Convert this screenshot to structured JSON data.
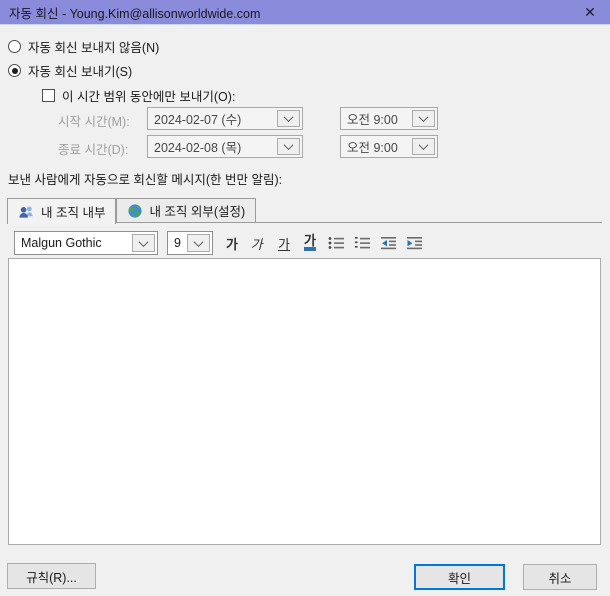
{
  "window": {
    "title": "자동 회신 - Young.Kim@allisonworldwide.com",
    "close_glyph": "✕"
  },
  "options": {
    "radio_no_reply_label": "자동 회신 보내지 않음(N)",
    "radio_no_reply_checked": false,
    "radio_send_label": "자동 회신 보내기(S)",
    "radio_send_checked": true,
    "checkbox_time_range_label": "이 시간 범위 동안에만 보내기(O):",
    "checkbox_time_range_checked": false,
    "start_label": "시작 시간(M):",
    "start_date": "2024-02-07 (수)",
    "start_time": "오전 9:00",
    "end_label": "종료 시간(D):",
    "end_date": "2024-02-08 (목)",
    "end_time": "오전 9:00"
  },
  "message_section": {
    "label": "보낸 사람에게 자동으로 회신할 메시지(한 번만 알림):",
    "tabs": [
      {
        "label": "내 조직 내부",
        "icon": "people-icon",
        "active": true
      },
      {
        "label": "내 조직 외부(설정)",
        "icon": "globe-icon",
        "active": false
      }
    ]
  },
  "editor": {
    "font_name": "Malgun Gothic",
    "font_size": "9",
    "bold_label": "가",
    "italic_label": "가",
    "underline_label": "가",
    "font_color_label": "가",
    "body_text": ""
  },
  "footer": {
    "rules_label": "규칙(R)...",
    "ok_label": "확인",
    "cancel_label": "취소"
  },
  "icons": {
    "close": "x-cross",
    "combo_dropdown": "chevron-down",
    "tab_internal": "two-people",
    "tab_external": "globe",
    "list_bullets": "bulleted-list",
    "list_numbers": "numbered-list",
    "outdent": "decrease-indent",
    "indent": "increase-indent"
  },
  "colors": {
    "titlebar": "#8b8bdc",
    "dialog_bg": "#f0f0f0",
    "accent_blue": "#0078d7",
    "font_color_underline": "#2e74b5"
  }
}
